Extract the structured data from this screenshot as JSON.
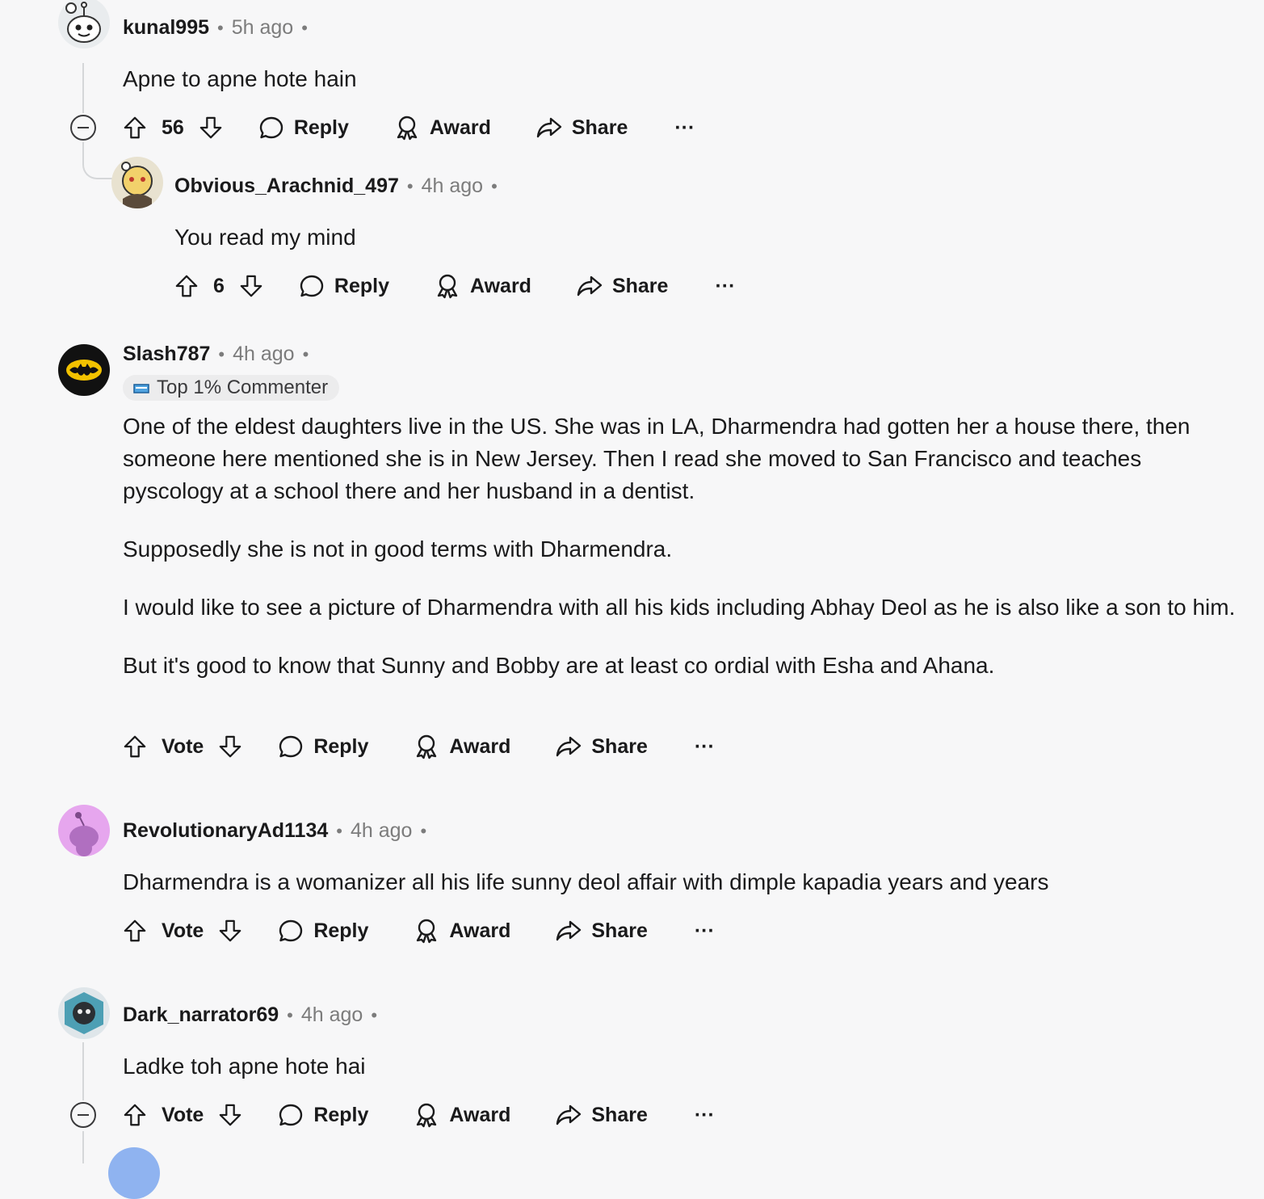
{
  "comments": [
    {
      "username": "kunal995",
      "time": "5h ago",
      "body": [
        "Apne to apne hote hain"
      ],
      "vote_label": "56"
    },
    {
      "username": "Obvious_Arachnid_497",
      "time": "4h ago",
      "body": [
        "You read my mind"
      ],
      "vote_label": "6"
    },
    {
      "username": "Slash787",
      "time": "4h ago",
      "flair": "Top 1% Commenter",
      "body": [
        "One of the eldest daughters live in the US. She was in LA, Dharmendra had gotten her a house there, then someone here mentioned she is in New Jersey. Then I read she moved to San Francisco and teaches pyscology at a school there and her husband in a dentist.",
        "Supposedly she is not in good terms with Dharmendra.",
        "I would like to see a picture of Dharmendra with all his kids including Abhay Deol as he is also like a son to him.",
        "But it's good to know that Sunny and Bobby are at least co ordial with Esha and Ahana."
      ],
      "vote_label": "Vote"
    },
    {
      "username": "RevolutionaryAd1134",
      "time": "4h ago",
      "body": [
        "Dharmendra is a womanizer all his life sunny deol affair with dimple kapadia years and years"
      ],
      "vote_label": "Vote"
    },
    {
      "username": "Dark_narrator69",
      "time": "4h ago",
      "body": [
        "Ladke toh apne hote hai"
      ],
      "vote_label": "Vote"
    }
  ],
  "actions": {
    "reply": "Reply",
    "award": "Award",
    "share": "Share",
    "more": "···"
  },
  "separator": "•",
  "colors": {
    "background": "#f7f7f8",
    "text": "#1a1a1b",
    "meta": "#7c7c7c",
    "thread_line": "#d5d7d9"
  }
}
